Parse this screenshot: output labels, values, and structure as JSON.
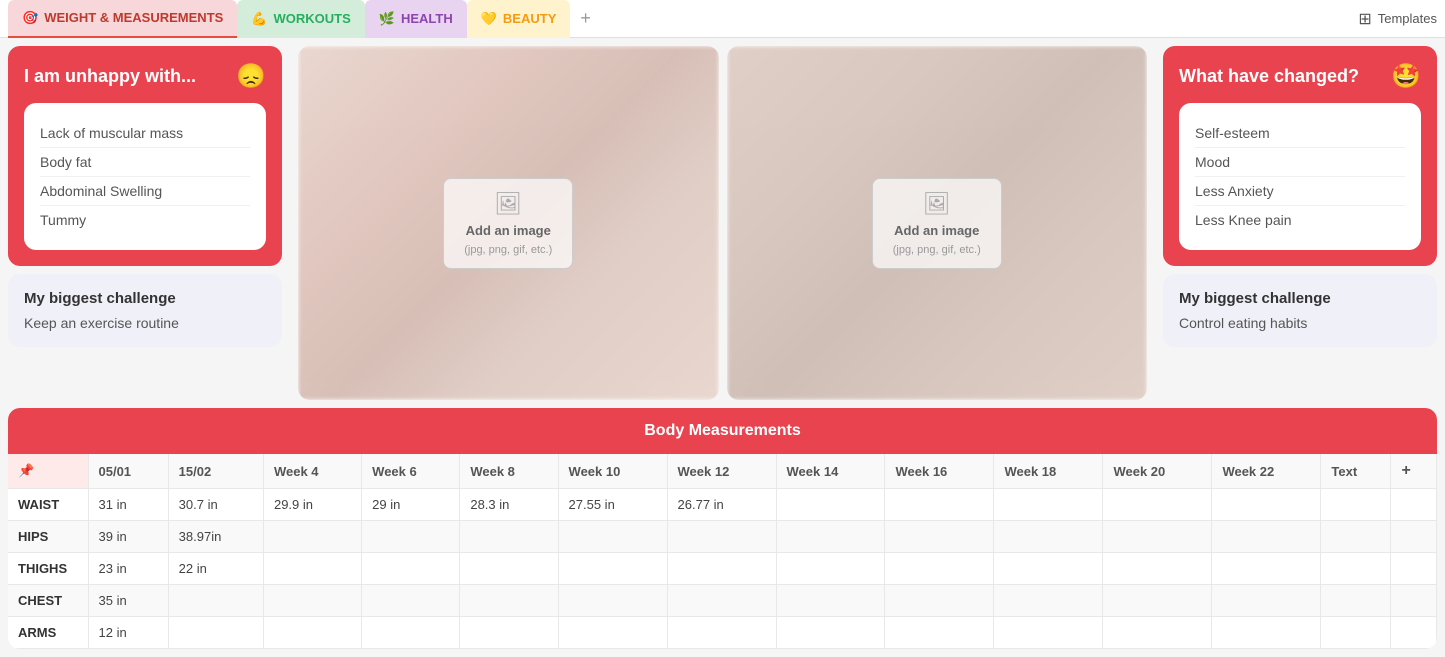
{
  "nav": {
    "tabs": [
      {
        "id": "weight",
        "label": "WEIGHT & MEASUREMENTS",
        "emoji": "🎯",
        "class": "weight"
      },
      {
        "id": "workouts",
        "label": "WORKOUTS",
        "emoji": "💪",
        "class": "workouts"
      },
      {
        "id": "health",
        "label": "HEALTH",
        "emoji": "🌿",
        "class": "health"
      },
      {
        "id": "beauty",
        "label": "BEAUTY",
        "emoji": "💛",
        "class": "beauty"
      }
    ],
    "add_label": "+",
    "templates_label": "Templates"
  },
  "left_panel": {
    "unhappy_card": {
      "title": "I am unhappy with...",
      "emoji": "😞",
      "items": [
        "Lack of muscular mass",
        "Body fat",
        "Abdominal Swelling",
        "Tummy"
      ]
    },
    "challenge_card": {
      "title": "My biggest challenge",
      "text": "Keep an exercise routine"
    }
  },
  "right_panel": {
    "changed_card": {
      "title": "What have changed?",
      "emoji": "🤩",
      "items": [
        "Self-esteem",
        "Mood",
        "Less Anxiety",
        "Less Knee pain"
      ]
    },
    "challenge_card": {
      "title": "My biggest challenge",
      "text": "Control eating habits"
    }
  },
  "image_panels": [
    {
      "upload_text": "Add an image",
      "upload_hint": "(jpg, png, gif, etc.)"
    },
    {
      "upload_text": "Add an image",
      "upload_hint": "(jpg, png, gif, etc.)"
    }
  ],
  "measurements": {
    "title": "Body Measurements",
    "columns": [
      "📌",
      "05/01",
      "15/02",
      "Week 4",
      "Week 6",
      "Week 8",
      "Week 10",
      "Week 12",
      "Week 14",
      "Week 16",
      "Week 18",
      "Week 20",
      "Week 22",
      "Text",
      "+"
    ],
    "rows": [
      {
        "label": "WAIST",
        "values": [
          "31 in",
          "30.7 in",
          "29.9 in",
          "29 in",
          "28.3 in",
          "27.55 in",
          "26.77 in",
          "",
          "",
          "",
          "",
          "",
          "",
          ""
        ]
      },
      {
        "label": "HIPS",
        "values": [
          "39 in",
          "38.97in",
          "",
          "",
          "",
          "",
          "",
          "",
          "",
          "",
          "",
          "",
          "",
          ""
        ]
      },
      {
        "label": "THIGHS",
        "values": [
          "23 in",
          "22 in",
          "",
          "",
          "",
          "",
          "",
          "",
          "",
          "",
          "",
          "",
          "",
          ""
        ]
      },
      {
        "label": "CHEST",
        "values": [
          "35 in",
          "",
          "",
          "",
          "",
          "",
          "",
          "",
          "",
          "",
          "",
          "",
          "",
          ""
        ]
      },
      {
        "label": "ARMS",
        "values": [
          "12 in",
          "",
          "",
          "",
          "",
          "",
          "",
          "",
          "",
          "",
          "",
          "",
          "",
          ""
        ]
      }
    ]
  }
}
